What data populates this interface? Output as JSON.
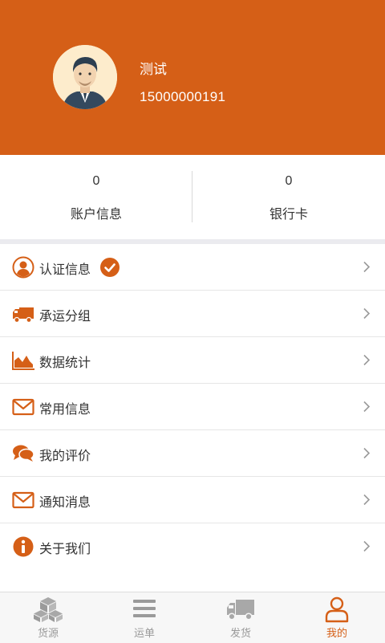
{
  "profile": {
    "name": "测试",
    "phone": "15000000191"
  },
  "stats": [
    {
      "value": "0",
      "label": "账户信息"
    },
    {
      "value": "0",
      "label": "银行卡"
    }
  ],
  "menu": [
    {
      "label": "认证信息",
      "icon": "user-circle-icon",
      "verified": true
    },
    {
      "label": "承运分组",
      "icon": "truck-icon"
    },
    {
      "label": "数据统计",
      "icon": "area-chart-icon"
    },
    {
      "label": "常用信息",
      "icon": "envelope-icon"
    },
    {
      "label": "我的评价",
      "icon": "comments-icon"
    },
    {
      "label": "通知消息",
      "icon": "envelope-icon"
    },
    {
      "label": "关于我们",
      "icon": "info-icon"
    }
  ],
  "tabs": [
    {
      "label": "货源",
      "icon": "boxes-icon",
      "active": false
    },
    {
      "label": "运单",
      "icon": "list-icon",
      "active": false
    },
    {
      "label": "发货",
      "icon": "truck-icon",
      "active": false
    },
    {
      "label": "我的",
      "icon": "user-icon",
      "active": true
    }
  ],
  "colors": {
    "accent": "#d55f17",
    "inactive": "#9a9a9a",
    "divider": "#e6e6e6"
  }
}
